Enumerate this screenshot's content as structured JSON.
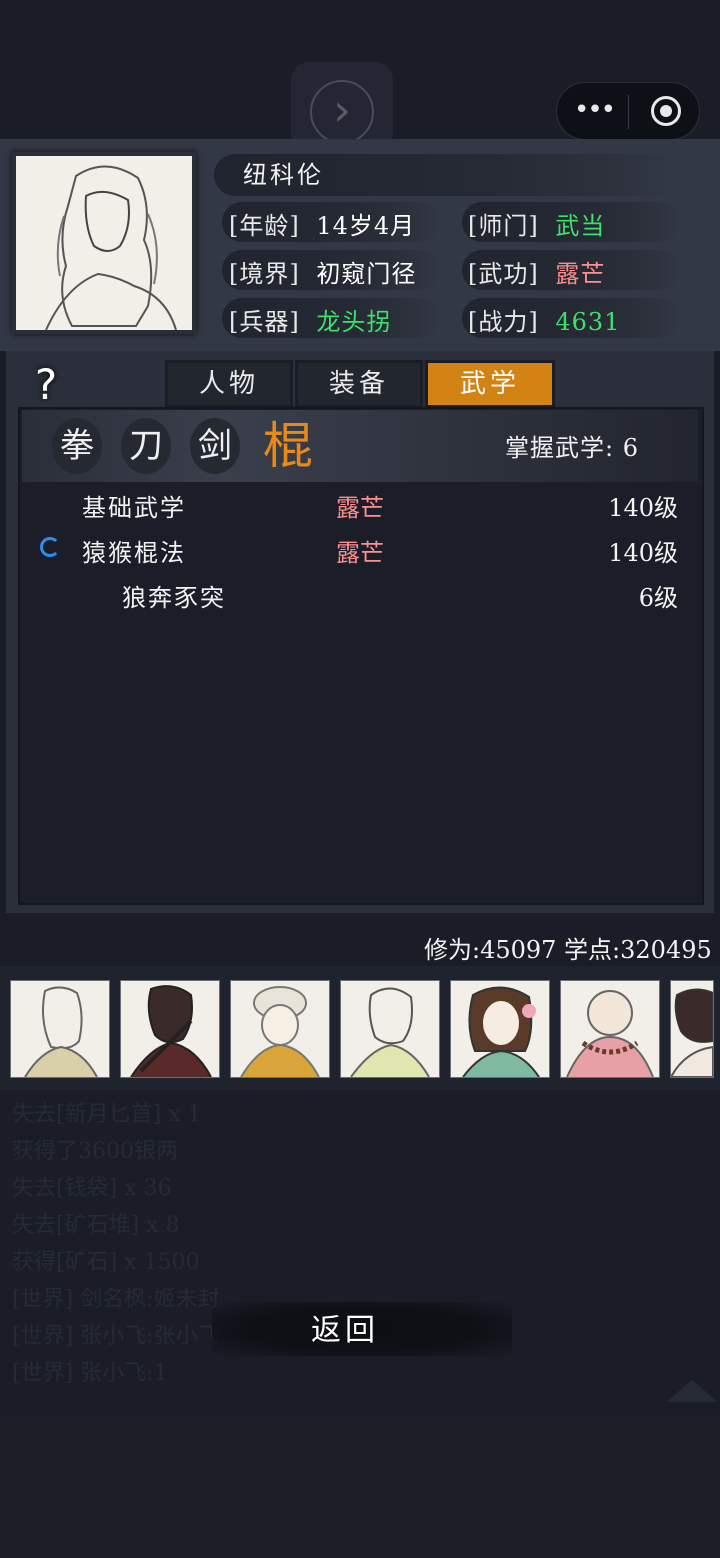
{
  "character": {
    "name": "纽科伦",
    "age_label": "[年龄]",
    "age": "14岁4月",
    "sect_label": "[师门]",
    "sect": "武当",
    "realm_label": "[境界]",
    "realm": "初窥门径",
    "skill_label": "[武功]",
    "skill": "露芒",
    "weapon_label": "[兵器]",
    "weapon": "龙头拐",
    "power_label": "[战力]",
    "power": "4631"
  },
  "tabs": [
    {
      "label": "人物",
      "active": false
    },
    {
      "label": "装备",
      "active": false
    },
    {
      "label": "武学",
      "active": true
    }
  ],
  "help_icon": "?",
  "categories": [
    {
      "label": "拳",
      "active": false
    },
    {
      "label": "刀",
      "active": false
    },
    {
      "label": "剑",
      "active": false
    },
    {
      "label": "棍",
      "active": true
    }
  ],
  "mastery": "掌握武学: 6",
  "skills": [
    {
      "name": "基础武学",
      "grade": "露芒",
      "level": "140级"
    },
    {
      "name": "猿猴棍法",
      "grade": "露芒",
      "level": "140级"
    },
    {
      "name": "狼奔豕突",
      "grade": "",
      "level": "6级"
    }
  ],
  "stats": "修为:45097  学点:320495",
  "party_icons": [
    "portrait-longhair",
    "portrait-swordsman",
    "portrait-monk-hat",
    "portrait-hairpin",
    "portrait-lady-flower",
    "portrait-bald-monk",
    "portrait-young"
  ],
  "log": [
    "失去[新月匕首] x 1",
    "获得了3600银两",
    "失去[钱袋] x 36",
    "失去[矿石堆] x 8",
    "获得[矿石] x 1500",
    "[世界] 剑名枫:姬未封",
    "[世界] 张小飞:张小飞",
    "[世界] 张小飞:1"
  ],
  "back_label": "返回",
  "colors": {
    "accent": "#d28314",
    "green": "#3fe06a",
    "pink": "#ff8f8f",
    "active_cat": "#e78a17"
  }
}
